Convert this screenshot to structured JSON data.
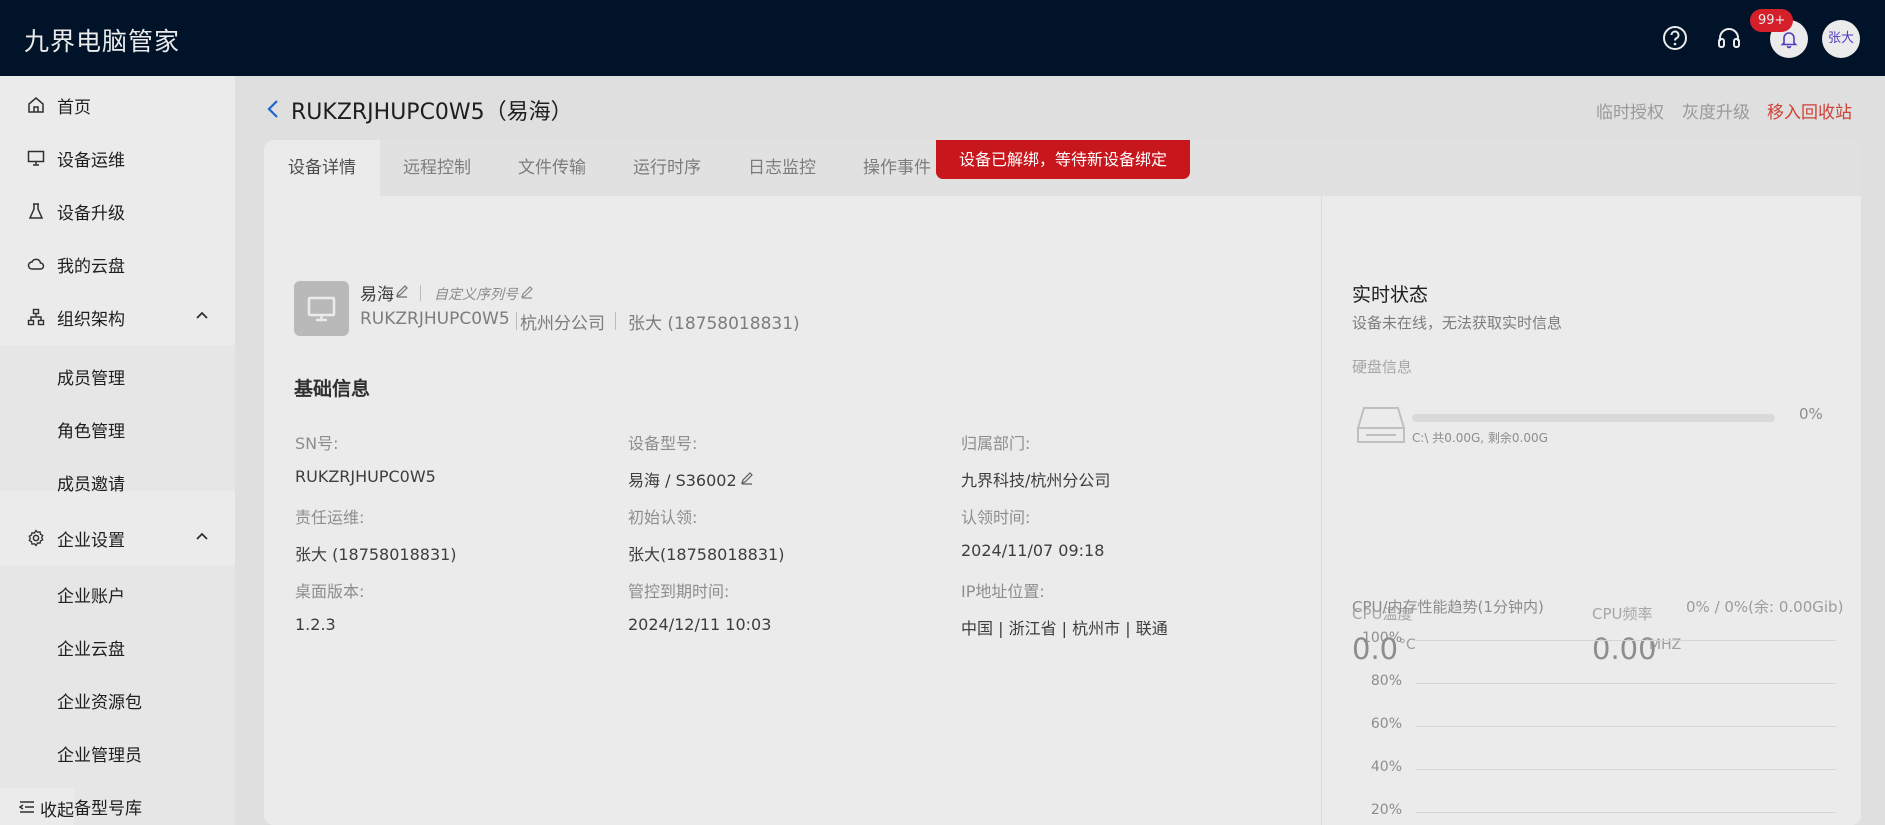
{
  "app": {
    "title": "九界电脑管家"
  },
  "topbar": {
    "notif_badge": "99+",
    "user": "张大"
  },
  "sidebar": {
    "items": [
      "首页",
      "设备运维",
      "设备升级",
      "我的云盘",
      "组织架构",
      "企业设置"
    ],
    "org_sub": [
      "成员管理",
      "角色管理",
      "成员邀请"
    ],
    "ent_sub": [
      "企业账户",
      "企业云盘",
      "企业资源包",
      "企业管理员",
      "设备型号库"
    ],
    "collapse_label": "收起"
  },
  "header": {
    "title": "RUKZRJHUPC0W5（易海）",
    "actions": [
      "临时授权",
      "灰度升级",
      "移入回收站"
    ]
  },
  "tabs": [
    "设备详情",
    "远程控制",
    "文件传输",
    "运行时序",
    "日志监控",
    "操作事件"
  ],
  "toast": "设备已解绑，等待新设备绑定",
  "device": {
    "name": "易海",
    "custom_sn": "自定义序列号",
    "sn": "RUKZRJHUPC0W5",
    "dept": "杭州分公司",
    "owner": "张大 (18758018831)"
  },
  "basic": {
    "title": "基础信息",
    "fields": [
      {
        "label": "SN号:",
        "value": "RUKZRJHUPC0W5"
      },
      {
        "label": "设备型号:",
        "value": "易海  / S36002"
      },
      {
        "label": "归属部门:",
        "value": "九界科技/杭州分公司"
      },
      {
        "label": "责任运维:",
        "value": "张大 (18758018831)"
      },
      {
        "label": "初始认领:",
        "value": "张大(18758018831)"
      },
      {
        "label": "认领时间:",
        "value": "2024/11/07 09:18"
      },
      {
        "label": "桌面版本:",
        "value": "1.2.3"
      },
      {
        "label": "管控到期时间:",
        "value": "2024/12/11 10:03"
      },
      {
        "label": "IP地址位置:",
        "value": "中国 | 浙江省 | 杭州市 | 联通"
      }
    ]
  },
  "realtime": {
    "title": "实时状态",
    "desc": "设备未在线，无法获取实时信息",
    "disk_label": "硬盘信息",
    "disk_pct": "0%",
    "disk_caption": "C:\\ 共0.00G, 剩余0.00G",
    "cpu_temp_label": "CPU温度",
    "cpu_temp": "0.0",
    "cpu_temp_unit": "°C",
    "cpu_freq_label": "CPU频率",
    "cpu_freq": "0.00",
    "cpu_freq_unit": "MHZ",
    "trend_label": "CPU/内存性能趋势(1分钟内)",
    "trend_value": "0% / 0%(余: 0.00Gib)",
    "y_ticks": [
      "100%",
      "80%",
      "60%",
      "40%",
      "20%"
    ]
  }
}
